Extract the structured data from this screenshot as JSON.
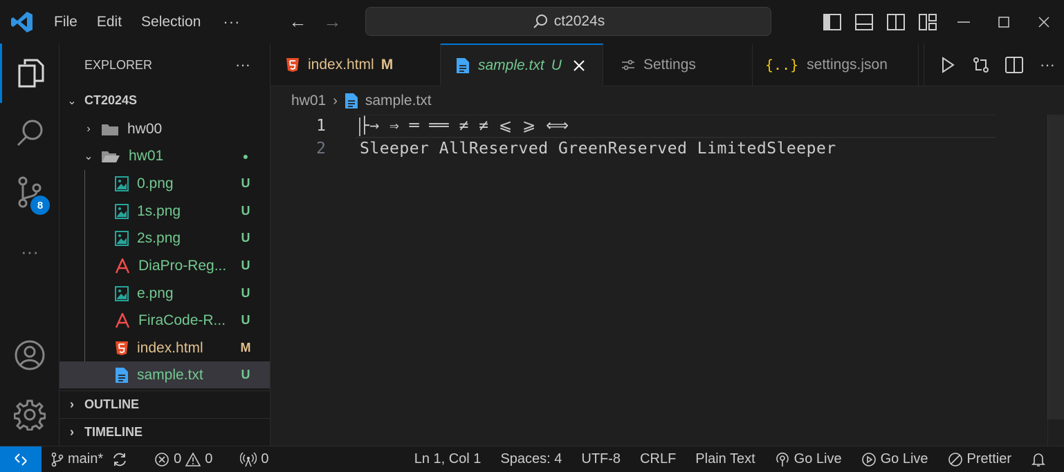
{
  "titlebar": {
    "menu": [
      "File",
      "Edit",
      "Selection"
    ],
    "more": "···",
    "search_text": "ct2024s"
  },
  "activity": {
    "scm_badge": "8"
  },
  "explorer": {
    "title": "EXPLORER",
    "more": "···",
    "root": "CT2024S",
    "items": [
      {
        "label": "hw00",
        "kind": "folder",
        "status": ""
      },
      {
        "label": "hw01",
        "kind": "folder-open",
        "status": "●"
      },
      {
        "label": "0.png",
        "kind": "image",
        "status": "U"
      },
      {
        "label": "1s.png",
        "kind": "image",
        "status": "U"
      },
      {
        "label": "2s.png",
        "kind": "image",
        "status": "U"
      },
      {
        "label": "DiaPro-Reg...",
        "kind": "font",
        "status": "U"
      },
      {
        "label": "e.png",
        "kind": "image",
        "status": "U"
      },
      {
        "label": "FiraCode-R...",
        "kind": "font",
        "status": "U"
      },
      {
        "label": "index.html",
        "kind": "html",
        "status": "M"
      },
      {
        "label": "sample.txt",
        "kind": "text",
        "status": "U"
      }
    ],
    "sections": [
      "OUTLINE",
      "TIMELINE"
    ]
  },
  "tabs": [
    {
      "label": "index.html",
      "status": "M"
    },
    {
      "label": "sample.txt",
      "status": "U"
    },
    {
      "label": "Settings",
      "status": ""
    },
    {
      "label": "settings.json",
      "status": ""
    }
  ],
  "breadcrumb": [
    "hw01",
    "sample.txt"
  ],
  "editor": {
    "lines": [
      {
        "number": "1",
        "text": "├→ ⇒ ═ ══ ≠ ≠ ⩽ ⩾ ⟺"
      },
      {
        "number": "2",
        "text": "Sleeper AllReserved GreenReserved LimitedSleeper"
      }
    ]
  },
  "status": {
    "branch": "main*",
    "errors": "0",
    "warnings": "0",
    "ports": "0",
    "position": "Ln 1, Col 1",
    "spaces": "Spaces: 4",
    "encoding": "UTF-8",
    "eol": "CRLF",
    "language": "Plain Text",
    "golive1": "Go Live",
    "golive2": "Go Live",
    "prettier": "Prettier"
  },
  "colors": {
    "accent": "#0078d4",
    "untracked": "#73c991",
    "modified": "#e2c08d",
    "html_icon": "#e44d26",
    "font_icon": "#f14c4c",
    "json_icon": "#f1c40f"
  }
}
